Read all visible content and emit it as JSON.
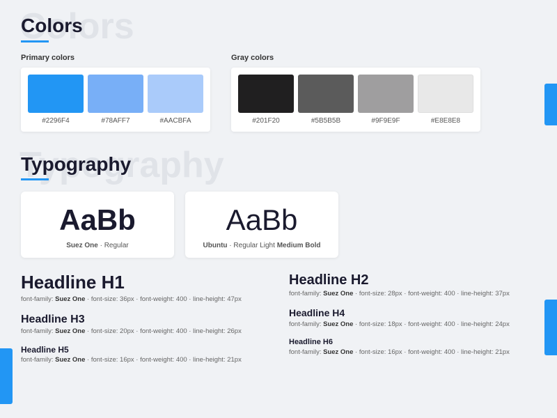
{
  "colors_section": {
    "bg_text": "Colors",
    "title": "Colors",
    "primary_group": {
      "label": "Primary colors",
      "swatches": [
        {
          "color": "#2296F4",
          "hex": "#2296F4"
        },
        {
          "color": "#78AFF7",
          "hex": "#78AFF7"
        },
        {
          "color": "#AACBFA",
          "hex": "#AACBFA"
        }
      ]
    },
    "gray_group": {
      "label": "Gray colors",
      "swatches": [
        {
          "color": "#201F20",
          "hex": "#201F20"
        },
        {
          "color": "#5B5B5B",
          "hex": "#5B5B5B"
        },
        {
          "color": "#9F9E9F",
          "hex": "#9F9E9F"
        },
        {
          "color": "#E8E8E8",
          "hex": "#E8E8E8"
        }
      ]
    }
  },
  "typography_section": {
    "bg_text": "Typography",
    "title": "Typography",
    "font_cards": [
      {
        "demo": "AaBb",
        "label": "Suez One",
        "style": "Regular",
        "bold": false
      },
      {
        "demo": "AaBb",
        "label": "Ubuntu",
        "style": "Regular Light Medium Bold",
        "bold": false
      }
    ],
    "headlines": {
      "left": [
        {
          "tag": "Headline H1",
          "meta": "font-family: Suez One · font-size: 36px · font-weight: 400 · line-height: 47px"
        },
        {
          "tag": "Headline H3",
          "meta": "font-family: Suez One · font-size: 20px · font-weight: 400 · line-height: 26px"
        },
        {
          "tag": "Headline H5",
          "meta": "font-family: Suez One · font-size: 16px · font-weight: 400 · line-height: 21px"
        }
      ],
      "right": [
        {
          "tag": "Headline H2",
          "meta": "font-family: Suez One · font-size: 28px · font-weight: 400 · line-height: 37px"
        },
        {
          "tag": "Headline H4",
          "meta": "font-family: Suez One · font-size: 18px · font-weight: 400 · line-height: 24px"
        },
        {
          "tag": "Headline H6",
          "meta": "font-family: Suez One · font-size: 16px · font-weight: 400 · line-height: 21px"
        }
      ]
    }
  }
}
